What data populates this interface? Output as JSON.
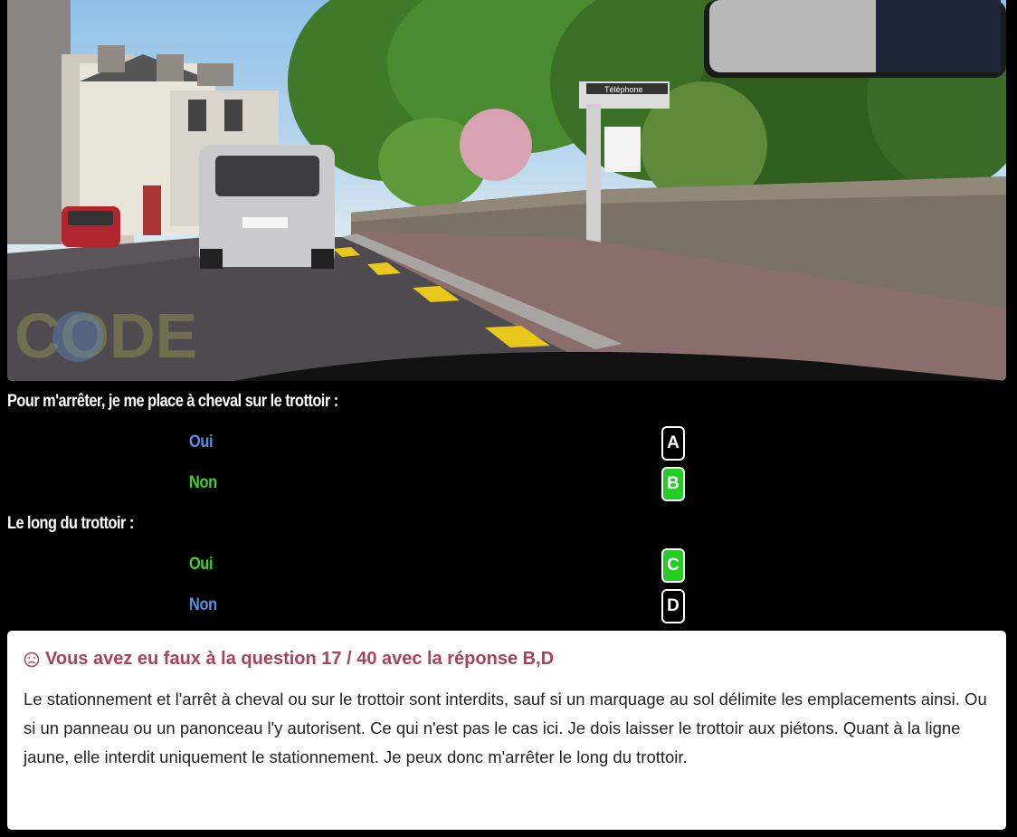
{
  "scene": {
    "sign_telephone": "Téléphone",
    "watermark": "CODE"
  },
  "questions": [
    {
      "text": "Pour m'arrêter, je me place à cheval sur le trottoir :",
      "answers": [
        {
          "label": "Oui",
          "letter": "A",
          "text_color": "#5b8ee6",
          "badge": "black"
        },
        {
          "label": "Non",
          "letter": "B",
          "text_color": "#3fd22a",
          "badge": "green"
        }
      ]
    },
    {
      "text": "Le long du trottoir :",
      "answers": [
        {
          "label": "Oui",
          "letter": "C",
          "text_color": "#3fd22a",
          "badge": "green"
        },
        {
          "label": "Non",
          "letter": "D",
          "text_color": "#5b8ee6",
          "badge": "black"
        }
      ]
    }
  ],
  "feedback": {
    "icon": "sad-face-icon",
    "title": "Vous avez eu faux à la question 17 / 40 avec la réponse B,D",
    "body": "Le stationnement et l'arrêt à cheval ou sur le trottoir sont interdits, sauf si un marquage au sol délimite les emplacements ainsi. Ou si un panneau ou un panonceau l'y autorisent. Ce qui n'est pas le cas ici. Je dois laisser le trottoir aux piétons. Quant à la ligne jaune, elle interdit uniquement le stationnement. Je peux donc m'arrêter le long du trottoir."
  },
  "colors": {
    "correct": "#22cc22",
    "blue_text": "#5b8ee6",
    "feedback_title": "#a8425c"
  }
}
